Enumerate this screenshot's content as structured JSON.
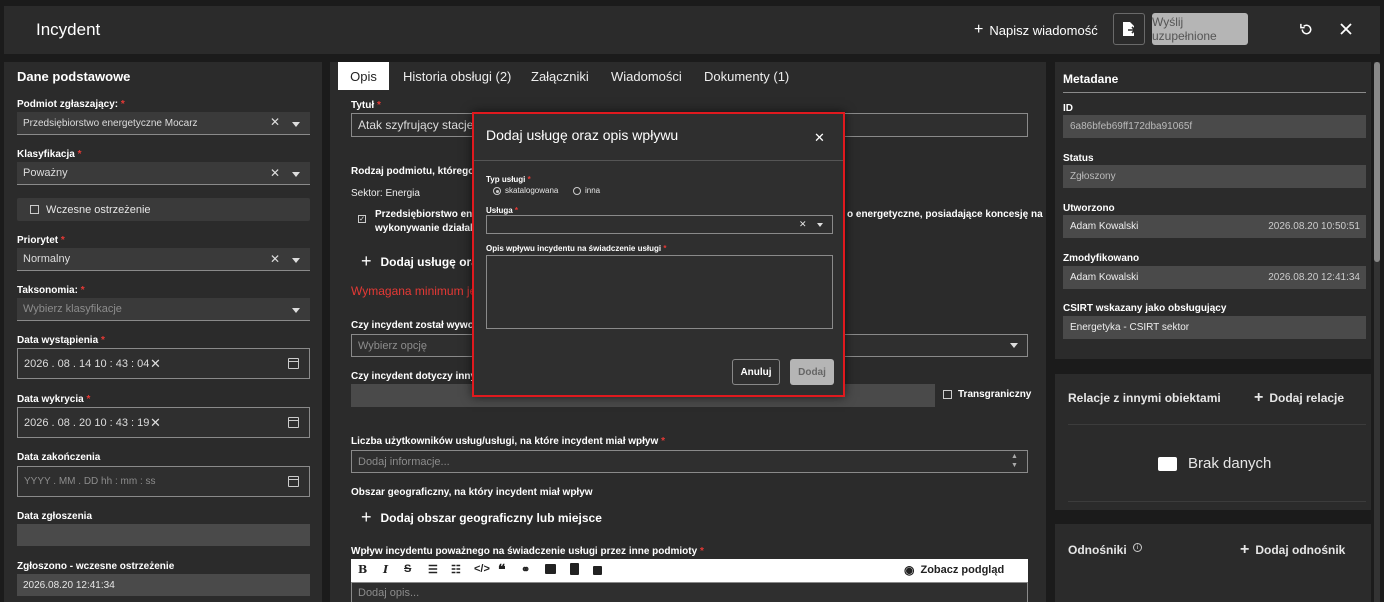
{
  "header": {
    "title": "Incydent",
    "write_message": "Napisz wiadomość",
    "send_label": "Wyślij uzupełnione"
  },
  "left": {
    "title": "Dane podstawowe",
    "reporter_label": "Podmiot zgłaszający:",
    "reporter_value": "Przedsiębiorstwo energetyczne Mocarz",
    "classification_label": "Klasyfikacja",
    "classification_value": "Poważny",
    "early_warning_label": "Wczesne ostrzeżenie",
    "priority_label": "Priorytet",
    "priority_value": "Normalny",
    "taxonomy_label": "Taksonomia:",
    "taxonomy_placeholder": "Wybierz klasyfikacje",
    "occurred_label": "Data wystąpienia",
    "occurred_value": "2026 . 08 . 14   10 : 43 : 04",
    "detected_label": "Data wykrycia",
    "detected_value": "2026 . 08 . 20   10 : 43 : 19",
    "ended_label": "Data zakończenia",
    "ended_placeholder": "YYYY . MM . DD   hh : mm : ss",
    "reported_label": "Data zgłoszenia",
    "early_reported_label": "Zgłoszono - wczesne ostrzeżenie",
    "early_reported_value": "2026.08.20 12:41:34"
  },
  "tabs": [
    {
      "label": "Opis"
    },
    {
      "label": "Historia obsługi (2)"
    },
    {
      "label": "Załączniki"
    },
    {
      "label": "Wiadomości"
    },
    {
      "label": "Dokumenty (1)"
    }
  ],
  "main": {
    "title_label": "Tytuł",
    "title_value": "Atak szyfrujący stacje r",
    "entity_type_label": "Rodzaj podmiotu, którego",
    "sector": "Sektor: Energia",
    "entity_desc_1": "Przedsiębiorstwo ene",
    "entity_desc_1b": "o energetyczne, posiadające koncesję na",
    "entity_desc_2": "wykonywanie działaln",
    "add_service": "Dodaj usługę ora",
    "min_required": "Wymagana minimum je",
    "caused_label": "Czy incydent został wywoła",
    "caused_placeholder": "Wybierz opcję",
    "concerns_label": "Czy incydent dotyczy innyc",
    "cross_border": "Transgraniczny",
    "users_label": "Liczba użytkowników usług/usługi, na które incydent miał wpływ",
    "users_placeholder": "Dodaj informacje...",
    "geo_label": "Obszar geograficzny, na który incydent miał wpływ",
    "add_geo": "Dodaj obszar geograficzny lub miejsce",
    "impact_label": "Wpływ incydentu poważnego na świadczenie usługi przez inne podmioty",
    "preview": "Zobacz podgląd",
    "desc_placeholder": "Dodaj opis..."
  },
  "meta": {
    "title": "Metadane",
    "id_label": "ID",
    "id_value": "6a86bfeb69ff172dba91065f",
    "status_label": "Status",
    "status_value": "Zgłoszony",
    "created_label": "Utworzono",
    "created_user": "Adam Kowalski",
    "created_date": "2026.08.20 10:50:51",
    "modified_label": "Zmodyfikowano",
    "modified_user": "Adam Kowalski",
    "modified_date": "2026.08.20 12:41:34",
    "csirt_label": "CSIRT wskazany jako obsługujący",
    "csirt_value": "Energetyka - CSIRT sektor"
  },
  "relations": {
    "title": "Relacje z innymi obiektami",
    "add": "Dodaj relacje",
    "empty": "Brak danych"
  },
  "links": {
    "title": "Odnośniki",
    "add": "Dodaj odnośnik"
  },
  "modal": {
    "title": "Dodaj usługę oraz opis wpływu",
    "service_type_label": "Typ usługi",
    "opt_catalog": "skatalogowana",
    "opt_other": "inna",
    "service_label": "Usługa",
    "impact_label": "Opis wpływu incydentu na świadczenie usługi",
    "cancel": "Anuluj",
    "add": "Dodaj"
  },
  "colors": {
    "accent_required": "#e53935",
    "modal_border": "#e0191e"
  }
}
